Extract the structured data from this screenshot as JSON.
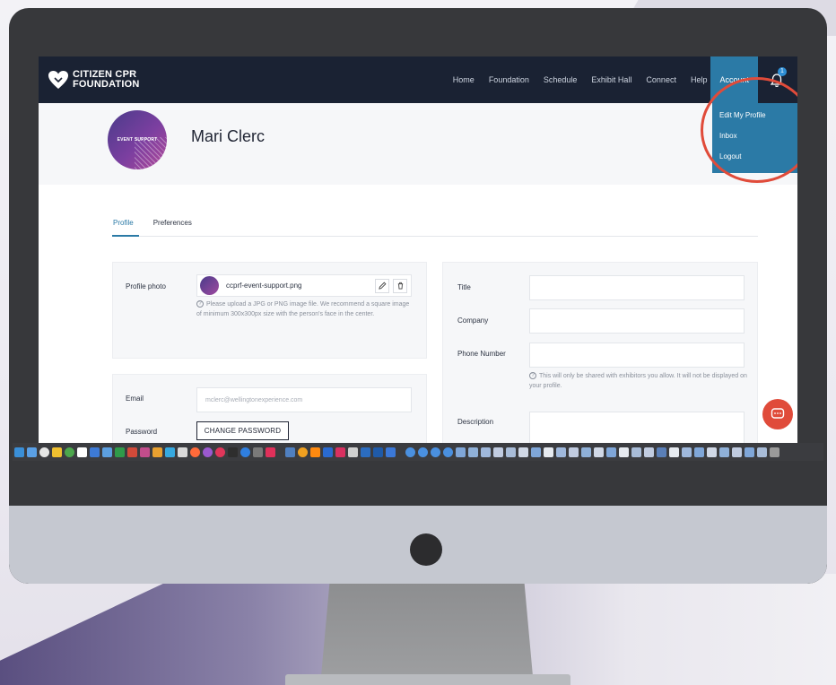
{
  "navbar": {
    "logo_line1": "CITIZEN CPR",
    "logo_line2": "FOUNDATION",
    "links": [
      "Home",
      "Foundation",
      "Schedule",
      "Exhibit Hall",
      "Connect",
      "Help"
    ],
    "account": "Account",
    "notification_count": "1"
  },
  "account_menu": {
    "items": [
      "Edit My Profile",
      "Inbox",
      "Logout"
    ]
  },
  "profile": {
    "avatar_text": "EVENT SUPPORT",
    "name": "Mari Clerc"
  },
  "tabs": [
    "Profile",
    "Preferences"
  ],
  "photo_card": {
    "label": "Profile photo",
    "file_name": "ccprf-event-support.png",
    "help": "Please upload a JPG or PNG image file. We recommend a square image of minimum 300x300px size with the person's face in the center."
  },
  "account_card": {
    "email_label": "Email",
    "email_value": "mclerc@wellingtonexperience.com",
    "password_label": "Password",
    "change_password": "CHANGE PASSWORD"
  },
  "details_card": {
    "title_label": "Title",
    "company_label": "Company",
    "phone_label": "Phone Number",
    "phone_help": "This will only be shared with exhibitors you allow. It will not be displayed on your profile.",
    "description_label": "Description"
  },
  "colors": {
    "navbar": "#1a2233",
    "accent": "#2b7aa6",
    "highlight_ring": "#e04b3a",
    "chat_button": "#e04b3a"
  }
}
